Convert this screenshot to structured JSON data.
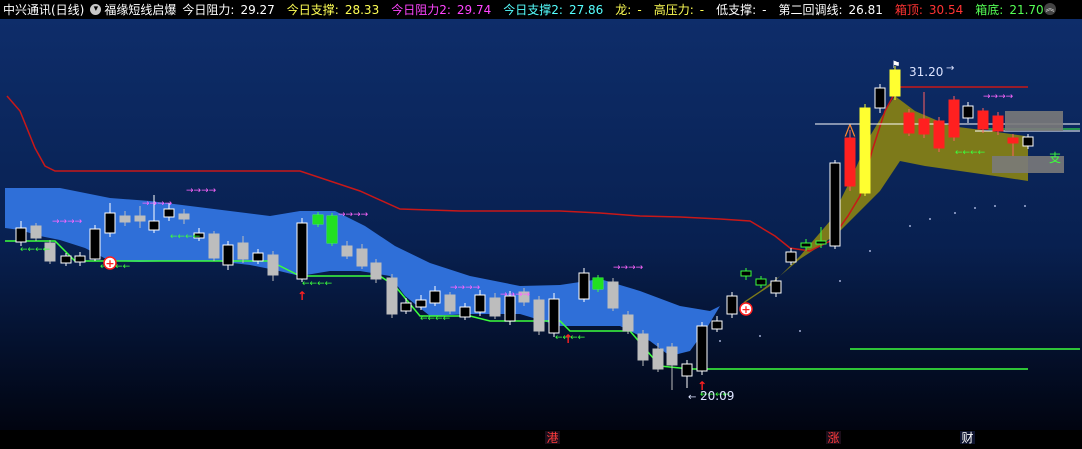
{
  "header": {
    "stock_name": "中兴通讯(日线)",
    "indicator_name": "福缘短线启爆",
    "items": [
      {
        "label": "今日阻力:",
        "value": "29.27",
        "color": "#ffffff"
      },
      {
        "label": "今日支撑:",
        "value": "28.33",
        "color": "#ffff55"
      },
      {
        "label": "今日阻力2:",
        "value": "29.74",
        "color": "#ff44ff"
      },
      {
        "label": "今日支撑2:",
        "value": "27.86",
        "color": "#55ffff"
      },
      {
        "label": "龙:",
        "value": "-",
        "color": "#ffff55"
      },
      {
        "label": "高压力:",
        "value": "-",
        "color": "#ffff55"
      },
      {
        "label": "低支撑:",
        "value": "-",
        "color": "#ffffff"
      },
      {
        "label": "第二回调线:",
        "value": "26.81",
        "color": "#ffffff"
      },
      {
        "label": "箱顶:",
        "value": "30.54",
        "color": "#ff3333"
      },
      {
        "label": "箱底:",
        "value": "21.70",
        "color": "#55ff55"
      }
    ],
    "menu_icon": "chevron-down-circle-icon",
    "nav_icon": "double-chevron-up-icon"
  },
  "annotations": {
    "high_price": "31.20",
    "low_price": "20.09",
    "support_label": "支"
  },
  "bottom_markers": [
    {
      "text": "港",
      "color": "#ff3b3b"
    },
    {
      "text": "涨",
      "color": "#ff3b3b"
    },
    {
      "text": "财",
      "color": "#ffffff"
    }
  ],
  "colors": {
    "bg_top": "#0d2a64",
    "bg_bottom": "#01050d",
    "blue_band": "#2f6fd8",
    "olive_band": "#7d7a1a",
    "red_line": "#c81818",
    "green_line": "#3cff3c",
    "candle_up": "#ff2020",
    "candle_down": "#101010",
    "candle_grey": "#bdbdbd"
  }
}
